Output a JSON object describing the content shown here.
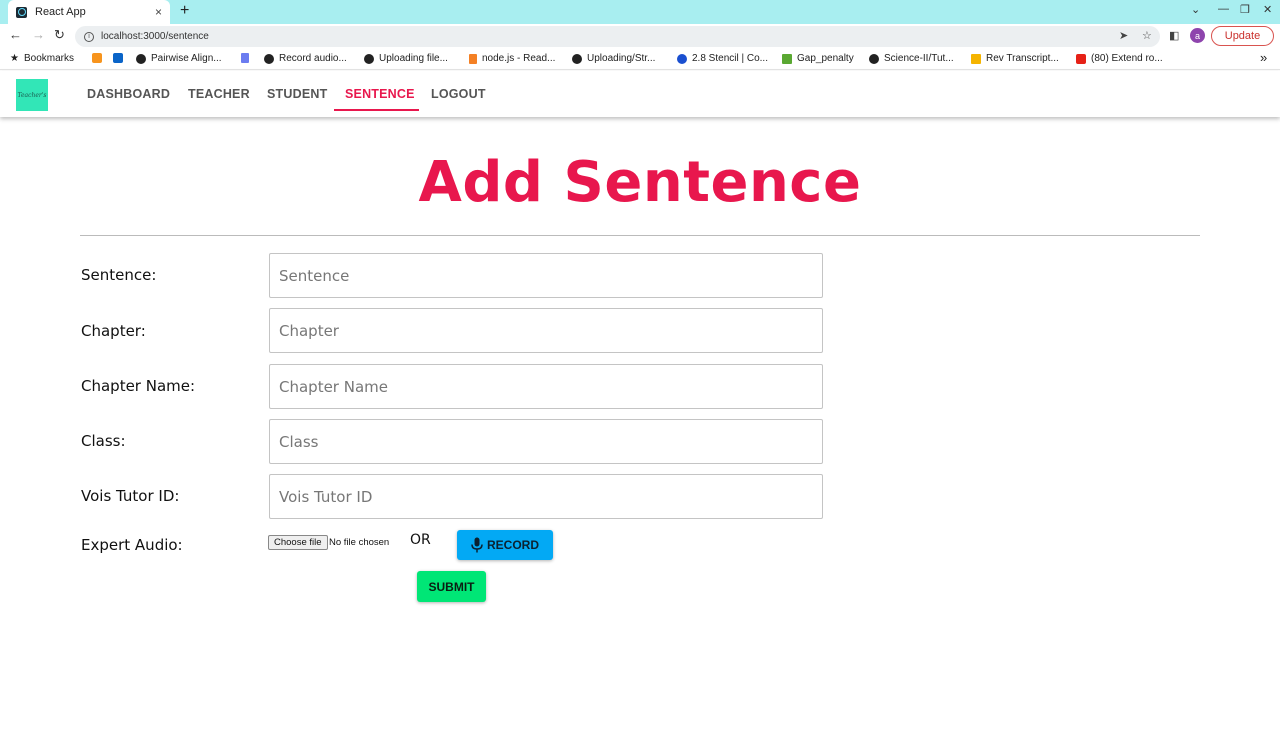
{
  "browser": {
    "tab_title": "React App",
    "tab_close": "×",
    "new_tab": "+",
    "url": "localhost:3000/sentence",
    "update_label": "Update",
    "avatar_letter": "a",
    "bookmarks": [
      "Bookmarks",
      "Pairwise Align...",
      "Record audio...",
      "Uploading file...",
      "node.js - Read...",
      "Uploading/Str...",
      "2.8 Stencil | Co...",
      "Gap_penalty",
      "Science-II/Tut...",
      "Rev Transcript...",
      "(80) Extend ro..."
    ],
    "more_bookmarks": "»"
  },
  "nav": {
    "logo_text": "Teacher's",
    "links": [
      "DASHBOARD",
      "TEACHER",
      "STUDENT",
      "SENTENCE",
      "LOGOUT"
    ],
    "active": "SENTENCE",
    "accent_color": "#e8174d"
  },
  "page": {
    "title": "Add Sentence",
    "fields": [
      {
        "label": "Sentence:",
        "placeholder": "Sentence"
      },
      {
        "label": "Chapter:",
        "placeholder": "Chapter"
      },
      {
        "label": "Chapter Name:",
        "placeholder": "Chapter Name"
      },
      {
        "label": "Class:",
        "placeholder": "Class"
      },
      {
        "label": "Vois Tutor ID:",
        "placeholder": "Vois Tutor ID"
      }
    ],
    "audio": {
      "label": "Expert Audio:",
      "choose_file": "Choose file",
      "no_file": "No file chosen",
      "or_text": "OR",
      "record_label": "RECORD",
      "record_color": "#03a9f4"
    },
    "submit_label": "SUBMIT",
    "submit_color": "#00e676"
  }
}
